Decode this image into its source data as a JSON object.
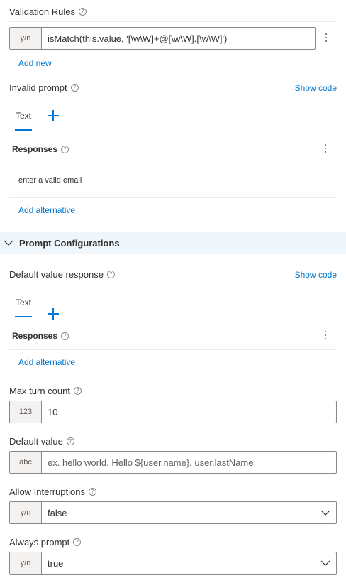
{
  "validation": {
    "title": "Validation Rules",
    "rule_prefix": "y/n",
    "rule_value": "isMatch(this.value, '[\\w\\W]+@[\\w\\W].[\\w\\W]')",
    "add_new": "Add new"
  },
  "invalid_prompt": {
    "title": "Invalid prompt",
    "show_code": "Show code",
    "tab_text": "Text",
    "responses_label": "Responses",
    "response_item": "enter a valid email",
    "add_alternative": "Add alternative"
  },
  "prompt_config": {
    "title": "Prompt Configurations"
  },
  "default_value_response": {
    "title": "Default value response",
    "show_code": "Show code",
    "tab_text": "Text",
    "responses_label": "Responses",
    "add_alternative": "Add alternative"
  },
  "max_turn_count": {
    "title": "Max turn count",
    "prefix": "123",
    "value": "10"
  },
  "default_value": {
    "title": "Default value",
    "prefix": "abc",
    "placeholder": "ex. hello world, Hello ${user.name}, user.lastName"
  },
  "allow_interruptions": {
    "title": "Allow Interruptions",
    "prefix": "y/n",
    "value": "false"
  },
  "always_prompt": {
    "title": "Always prompt",
    "prefix": "y/n",
    "value": "true"
  },
  "icons": {
    "help": "?",
    "help_icon": "help-circle-icon",
    "more_icon": "more-vertical-icon",
    "add_icon": "plus-icon",
    "chevron_down": "chevron-down-icon"
  },
  "colors": {
    "accent": "#0078d4",
    "section_bg": "#eff6fc",
    "text": "#323130"
  }
}
